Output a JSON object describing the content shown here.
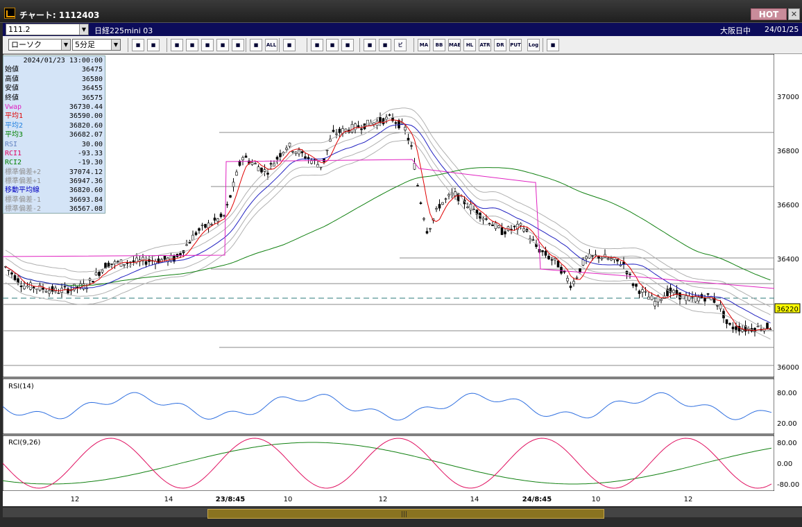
{
  "titlebar": {
    "title": "チャート: 1112403",
    "hot_label": "HOT",
    "close_label": "✕"
  },
  "toolbar1": {
    "symbol_code": "111.2",
    "symbol_name": "日経225mini 03",
    "chart_type": "ローソク",
    "interval": "5分足",
    "market": "大阪日中",
    "date": "24/01/25"
  },
  "toolbar2": {
    "buttons": [
      "zoom-icon",
      "grid-icon",
      "pointer-icon",
      "box-icon",
      "cross-icon",
      "lock-icon",
      "candle-icon",
      "candle2-icon",
      "ALL",
      "pen-icon",
      "arrow-icon",
      "undo-icon",
      "gear-icon",
      "wrench-icon",
      "palette-icon",
      "ビ",
      "MA",
      "BB",
      "MAE",
      "HL",
      "ATR",
      "DR",
      "PUT",
      "Log",
      "export-icon"
    ]
  },
  "infobox": {
    "datetime": "2024/01/23  13:00:00",
    "rows": [
      {
        "k": "始値",
        "v": "36475",
        "c": "#000"
      },
      {
        "k": "高値",
        "v": "36580",
        "c": "#000"
      },
      {
        "k": "安値",
        "v": "36455",
        "c": "#000"
      },
      {
        "k": "終値",
        "v": "36575",
        "c": "#000"
      },
      {
        "k": "Vwap",
        "v": "36730.44",
        "c": "#e020c0"
      },
      {
        "k": "平均1",
        "v": "36590.00",
        "c": "#e00000"
      },
      {
        "k": "平均2",
        "v": "36820.60",
        "c": "#2080e0"
      },
      {
        "k": "平均3",
        "v": "36682.07",
        "c": "#008000"
      },
      {
        "k": "RSI",
        "v": "30.00",
        "c": "#6080c0"
      },
      {
        "k": "RCI1",
        "v": "-93.33",
        "c": "#e00060"
      },
      {
        "k": "RCI2",
        "v": "-19.30",
        "c": "#008000"
      },
      {
        "k": "標準偏差+2",
        "v": "37074.12",
        "c": "#909090"
      },
      {
        "k": "標準偏差+1",
        "v": "36947.36",
        "c": "#909090"
      },
      {
        "k": "移動平均線",
        "v": "36820.60",
        "c": "#0000c0"
      },
      {
        "k": "標準偏差-1",
        "v": "36693.84",
        "c": "#909090"
      },
      {
        "k": "標準偏差-2",
        "v": "36567.08",
        "c": "#909090"
      }
    ]
  },
  "price_axis": {
    "labels": [
      "37000",
      "36800",
      "36600",
      "36400",
      "36000"
    ],
    "current_price": "36220",
    "current_color": "#ffff00"
  },
  "rsi_panel": {
    "title": "RSI(14)",
    "labels": [
      "80.00",
      "20.00"
    ]
  },
  "rci_panel": {
    "title": "RCI(9,26)",
    "labels": [
      "80.00",
      "0.00",
      "-80.00"
    ]
  },
  "time_axis": {
    "labels": [
      "12",
      "14",
      "23/8:45",
      "10",
      "12",
      "14",
      "24/8:45",
      "10",
      "12"
    ]
  },
  "colors": {
    "vwap": "#e020c0",
    "ma1": "#e00000",
    "ma2": "#2020c0",
    "ma3": "#108010",
    "bands": "#b0b0b0",
    "rsi": "#3070e0",
    "rci1": "#e01060",
    "rci2": "#108010"
  }
}
